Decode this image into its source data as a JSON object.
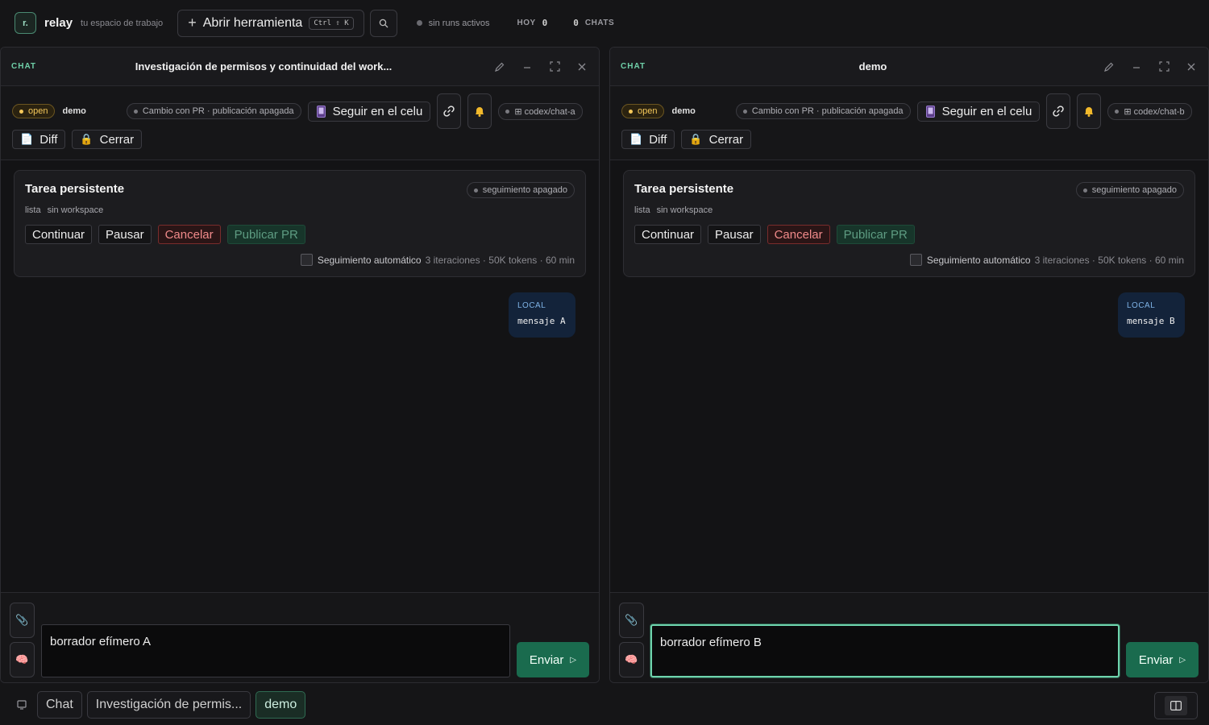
{
  "topbar": {
    "logo": "r.",
    "brand": "relay",
    "tagline": "tu espacio de trabajo",
    "open_tool_label": "Abrir herramienta",
    "shortcut": "Ctrl ⇧ K",
    "runs_status": "sin runs activos",
    "today_label": "HOY",
    "today_count": "0",
    "chats_count": "0",
    "chats_label": "CHATS"
  },
  "panels": [
    {
      "kind": "CHAT",
      "title": "Investigación de permisos y continuidad del work...",
      "status": "open",
      "workspace": "demo",
      "mode_pill": "Cambio con PR · publicación apagada",
      "follow_phone": "Seguir en el celu",
      "branch": "⊞ codex/chat-a",
      "diff_label": "Diff",
      "close_label": "Cerrar",
      "task": {
        "title": "Tarea persistente",
        "status": "seguimiento apagado",
        "state": "lista",
        "workspace": "sin workspace",
        "continue": "Continuar",
        "pause": "Pausar",
        "cancel": "Cancelar",
        "publish": "Publicar PR",
        "auto_label": "Seguimiento automático",
        "limits": "3 iteraciones · 50K tokens · 60 min"
      },
      "message": {
        "source": "LOCAL",
        "text": "mensaje A"
      },
      "draft": "borrador efímero A",
      "send_label": "Enviar"
    },
    {
      "kind": "CHAT",
      "title": "demo",
      "status": "open",
      "workspace": "demo",
      "mode_pill": "Cambio con PR · publicación apagada",
      "follow_phone": "Seguir en el celu",
      "branch": "⊞ codex/chat-b",
      "diff_label": "Diff",
      "close_label": "Cerrar",
      "task": {
        "title": "Tarea persistente",
        "status": "seguimiento apagado",
        "state": "lista",
        "workspace": "sin workspace",
        "continue": "Continuar",
        "pause": "Pausar",
        "cancel": "Cancelar",
        "publish": "Publicar PR",
        "auto_label": "Seguimiento automático",
        "limits": "3 iteraciones · 50K tokens · 60 min"
      },
      "message": {
        "source": "LOCAL",
        "text": "mensaje B"
      },
      "draft": "borrador efímero B",
      "send_label": "Enviar"
    }
  ],
  "bottombar": {
    "tabs": [
      "Chat",
      "Investigación de permis...",
      "demo"
    ]
  },
  "colors": {
    "accent": "#6fcfa8",
    "send": "#1a6b4e",
    "open_badge": "#f5c85a",
    "danger": "#f08a8a"
  },
  "icons": [
    "search-icon",
    "pencil-icon",
    "minimize-icon",
    "expand-icon",
    "close-icon",
    "link-icon",
    "bell-icon",
    "phone-icon",
    "file-icon",
    "lock-icon",
    "paperclip-icon",
    "brain-icon",
    "chat-icon",
    "split-layout-icon"
  ]
}
